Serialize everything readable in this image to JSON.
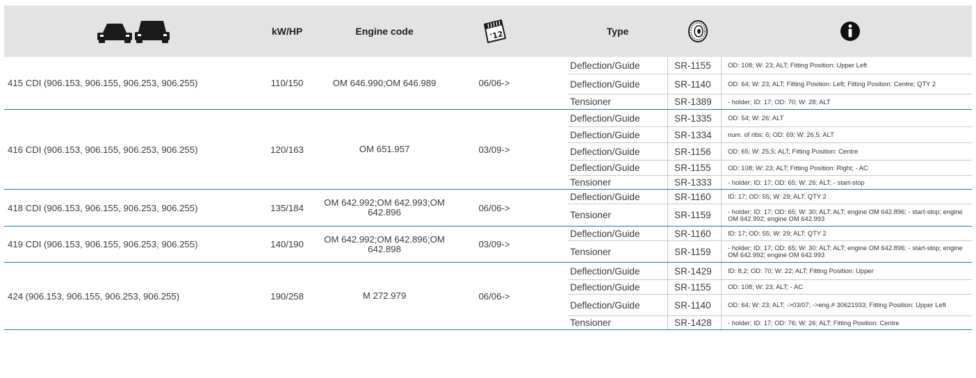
{
  "header": {
    "cars_icon": "two-cars-icon",
    "kw_label": "kW/HP",
    "engine_label": "Engine code",
    "calendar_icon": "calendar-icon",
    "calendar_text": "'12",
    "type_label": "Type",
    "tire_icon": "tire-icon",
    "info_icon": "info-icon"
  },
  "groups": [
    {
      "model": "415 CDI (906.153, 906.155, 906.253, 906.255)",
      "kw": "110/150",
      "engine": "OM 646.990;OM 646.989",
      "date": "06/06->",
      "parts": [
        {
          "type": "Deflection/Guide",
          "ref": "SR-1155",
          "note": "OD: 108; W: 23; ALT; Fitting Position: Upper Left"
        },
        {
          "type": "Deflection/Guide",
          "ref": "SR-1140",
          "note": "OD: 64; W: 23; ALT; Fitting Position: Left; Fitting Position: Centre; QTY 2"
        },
        {
          "type": "Tensioner",
          "ref": "SR-1389",
          "note": "- holder; ID: 17; OD: 70; W: 28; ALT"
        }
      ]
    },
    {
      "model": "416 CDI (906.153, 906.155, 906.253, 906.255)",
      "kw": "120/163",
      "engine": "OM 651.957",
      "date": "03/09->",
      "parts": [
        {
          "type": "Deflection/Guide",
          "ref": "SR-1335",
          "note": "OD: 54; W: 26; ALT"
        },
        {
          "type": "Deflection/Guide",
          "ref": "SR-1334",
          "note": "num. of ribs: 6; OD: 69; W: 26,5; ALT"
        },
        {
          "type": "Deflection/Guide",
          "ref": "SR-1156",
          "note": "OD: 65; W: 25,5; ALT; Fitting Position: Centre"
        },
        {
          "type": "Deflection/Guide",
          "ref": "SR-1155",
          "note": "OD: 108; W: 23; ALT; Fitting Position: Right; - AC"
        },
        {
          "type": "Tensioner",
          "ref": "SR-1333",
          "note": "- holder; ID: 17; OD: 65; W: 26; ALT; - start-stop"
        }
      ]
    },
    {
      "model": "418 CDI (906.153, 906.155, 906.253, 906.255)",
      "kw": "135/184",
      "engine": "OM 642.992;OM 642.993;OM 642.896",
      "date": "06/06->",
      "parts": [
        {
          "type": "Deflection/Guide",
          "ref": "SR-1160",
          "note": "ID: 17; OD: 55; W: 29; ALT; QTY 2"
        },
        {
          "type": "Tensioner",
          "ref": "SR-1159",
          "note": "- holder; ID: 17; OD: 65; W: 30; ALT; ALT; engine OM 642.896; - start-stop; engine OM 642.992; engine OM 642.993"
        }
      ]
    },
    {
      "model": "419 CDI (906.153, 906.155, 906.253, 906.255)",
      "kw": "140/190",
      "engine": "OM 642.992;OM 642.896;OM 642.898",
      "date": "03/09->",
      "parts": [
        {
          "type": "Deflection/Guide",
          "ref": "SR-1160",
          "note": "ID: 17; OD: 55; W: 29; ALT; QTY 2"
        },
        {
          "type": "Tensioner",
          "ref": "SR-1159",
          "note": "- holder; ID: 17; OD: 65; W: 30; ALT; ALT; engine OM 642.896; - start-stop; engine OM 642.992; engine OM 642.993"
        }
      ]
    },
    {
      "model": "424 (906.153, 906.155, 906.253, 906.255)",
      "kw": "190/258",
      "engine": "M 272.979",
      "date": "06/06->",
      "parts": [
        {
          "type": "Deflection/Guide",
          "ref": "SR-1429",
          "note": "ID: 8,2; OD: 70; W: 22; ALT; Fitting Position: Upper"
        },
        {
          "type": "Deflection/Guide",
          "ref": "SR-1155",
          "note": "OD: 108; W: 23; ALT; - AC"
        },
        {
          "type": "Deflection/Guide",
          "ref": "SR-1140",
          "note": "OD: 64; W: 23; ALT; ->03/07; ->eng.# 30621933; Fitting Position: Upper Left"
        },
        {
          "type": "Tensioner",
          "ref": "SR-1428",
          "note": "- holder; ID: 17; OD: 76; W: 26; ALT; Fitting Position: Centre"
        }
      ]
    }
  ]
}
